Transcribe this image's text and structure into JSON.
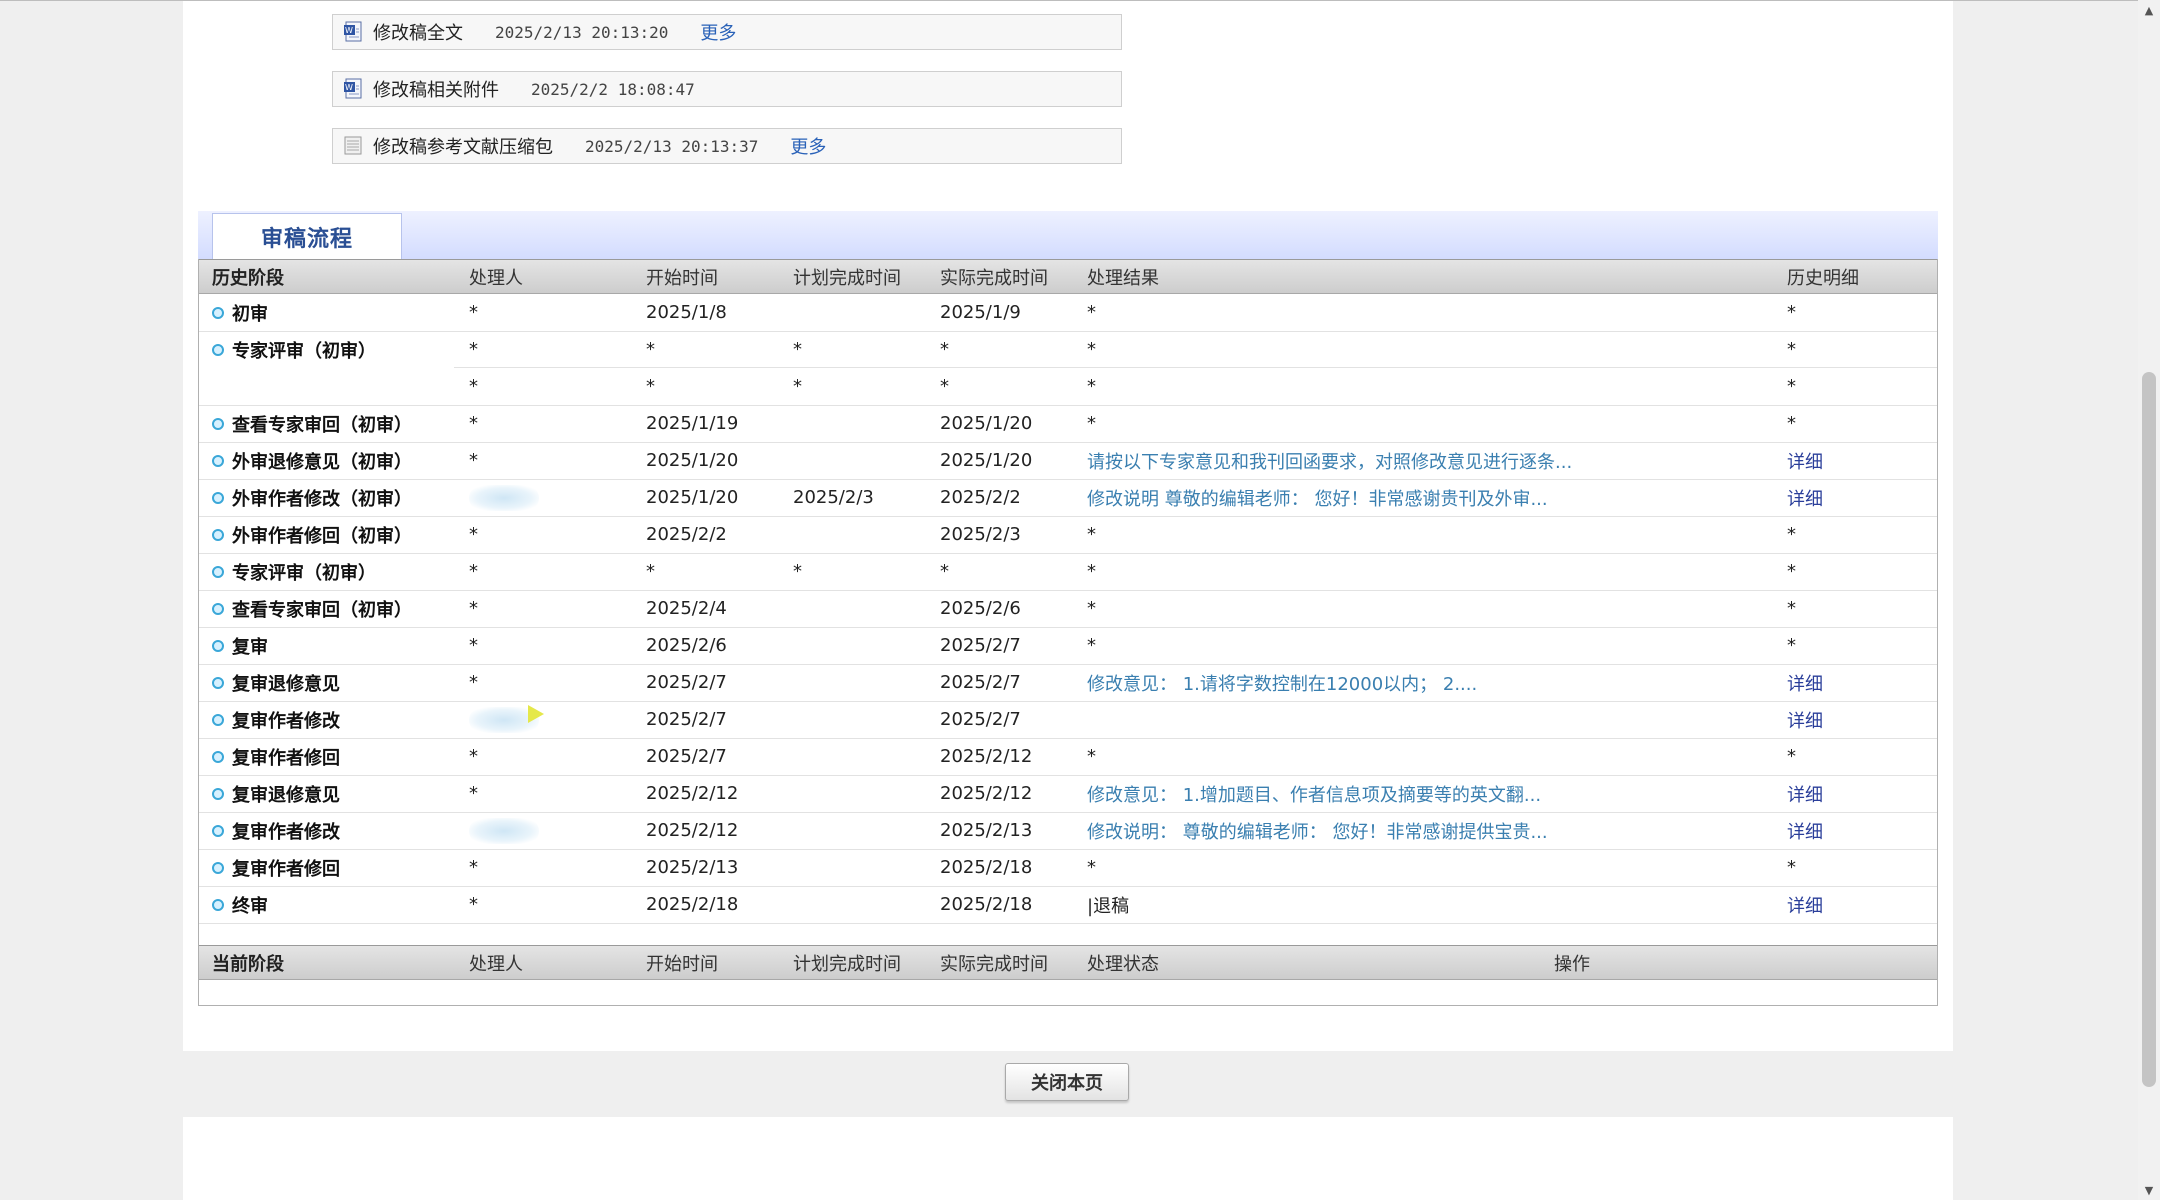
{
  "attachments": [
    {
      "name": "修改稿全文",
      "time": "2025/2/13 20:13:20",
      "more": "更多",
      "icon": "word-doc-icon"
    },
    {
      "name": "修改稿相关附件",
      "time": "2025/2/2 18:08:47",
      "more": "",
      "icon": "word-doc-icon"
    },
    {
      "name": "修改稿参考文献压缩包",
      "time": "2025/2/13 20:13:37",
      "more": "更多",
      "icon": "archive-file-icon"
    }
  ],
  "process": {
    "tab_title": "审稿流程",
    "history_headers": [
      "历史阶段",
      "处理人",
      "开始时间",
      "计划完成时间",
      "实际完成时间",
      "处理结果",
      "历史明细"
    ],
    "rows": [
      {
        "stage": "初审",
        "handler": "*",
        "start": "2025/1/8",
        "planned": "",
        "actual": "2025/1/9",
        "result": "*",
        "detail": "*"
      },
      {
        "stage": "专家评审（初审）",
        "handler": "*",
        "start": "*",
        "planned": "*",
        "actual": "*",
        "result": "*",
        "detail": "*"
      },
      {
        "stage": "",
        "handler": "*",
        "start": "*",
        "planned": "*",
        "actual": "*",
        "result": "*",
        "detail": "*"
      },
      {
        "stage": "查看专家审回（初审）",
        "handler": "*",
        "start": "2025/1/19",
        "planned": "",
        "actual": "2025/1/20",
        "result": "*",
        "detail": "*"
      },
      {
        "stage": "外审退修意见（初审）",
        "handler": "*",
        "start": "2025/1/20",
        "planned": "",
        "actual": "2025/1/20",
        "result": "请按以下专家意见和我刊回函要求，对照修改意见进行逐条...",
        "detail": "详细"
      },
      {
        "stage": "外审作者修改（初审）",
        "handler": "",
        "start": "2025/1/20",
        "planned": "2025/2/3",
        "actual": "2025/2/2",
        "result": "修改说明 尊敬的编辑老师： 您好！非常感谢贵刊及外审...",
        "detail": "详细"
      },
      {
        "stage": "外审作者修回（初审）",
        "handler": "*",
        "start": "2025/2/2",
        "planned": "",
        "actual": "2025/2/3",
        "result": "*",
        "detail": "*"
      },
      {
        "stage": "专家评审（初审）",
        "handler": "*",
        "start": "*",
        "planned": "*",
        "actual": "*",
        "result": "*",
        "detail": "*"
      },
      {
        "stage": "查看专家审回（初审）",
        "handler": "*",
        "start": "2025/2/4",
        "planned": "",
        "actual": "2025/2/6",
        "result": "*",
        "detail": "*"
      },
      {
        "stage": "复审",
        "handler": "*",
        "start": "2025/2/6",
        "planned": "",
        "actual": "2025/2/7",
        "result": "*",
        "detail": "*"
      },
      {
        "stage": "复审退修意见",
        "handler": "*",
        "start": "2025/2/7",
        "planned": "",
        "actual": "2025/2/7",
        "result": "修改意见： 1.请将字数控制在12000以内； 2....",
        "detail": "详细"
      },
      {
        "stage": "复审作者修改",
        "handler": "",
        "start": "2025/2/7",
        "planned": "",
        "actual": "2025/2/7",
        "result": "",
        "detail": "详细"
      },
      {
        "stage": "复审作者修回",
        "handler": "*",
        "start": "2025/2/7",
        "planned": "",
        "actual": "2025/2/12",
        "result": "*",
        "detail": "*"
      },
      {
        "stage": "复审退修意见",
        "handler": "*",
        "start": "2025/2/12",
        "planned": "",
        "actual": "2025/2/12",
        "result": "修改意见： 1.增加题目、作者信息项及摘要等的英文翻...",
        "detail": "详细"
      },
      {
        "stage": "复审作者修改",
        "handler": "",
        "start": "2025/2/12",
        "planned": "",
        "actual": "2025/2/13",
        "result": "修改说明： 尊敬的编辑老师： 您好！非常感谢提供宝贵...",
        "detail": "详细"
      },
      {
        "stage": "复审作者修回",
        "handler": "*",
        "start": "2025/2/13",
        "planned": "",
        "actual": "2025/2/18",
        "result": "*",
        "detail": "*"
      },
      {
        "stage": "终审",
        "handler": "*",
        "start": "2025/2/18",
        "planned": "",
        "actual": "2025/2/18",
        "result": "|退稿",
        "detail": "详细"
      }
    ],
    "current_headers": [
      "当前阶段",
      "处理人",
      "开始时间",
      "计划完成时间",
      "实际完成时间",
      "处理状态",
      "操作"
    ]
  },
  "footer": {
    "close_label": "关闭本页"
  },
  "colors": {
    "accent": "#2a4f94",
    "link": "#3a7fb0",
    "detail_link": "#2a3e9a",
    "bullet": "#3aa7d8"
  }
}
